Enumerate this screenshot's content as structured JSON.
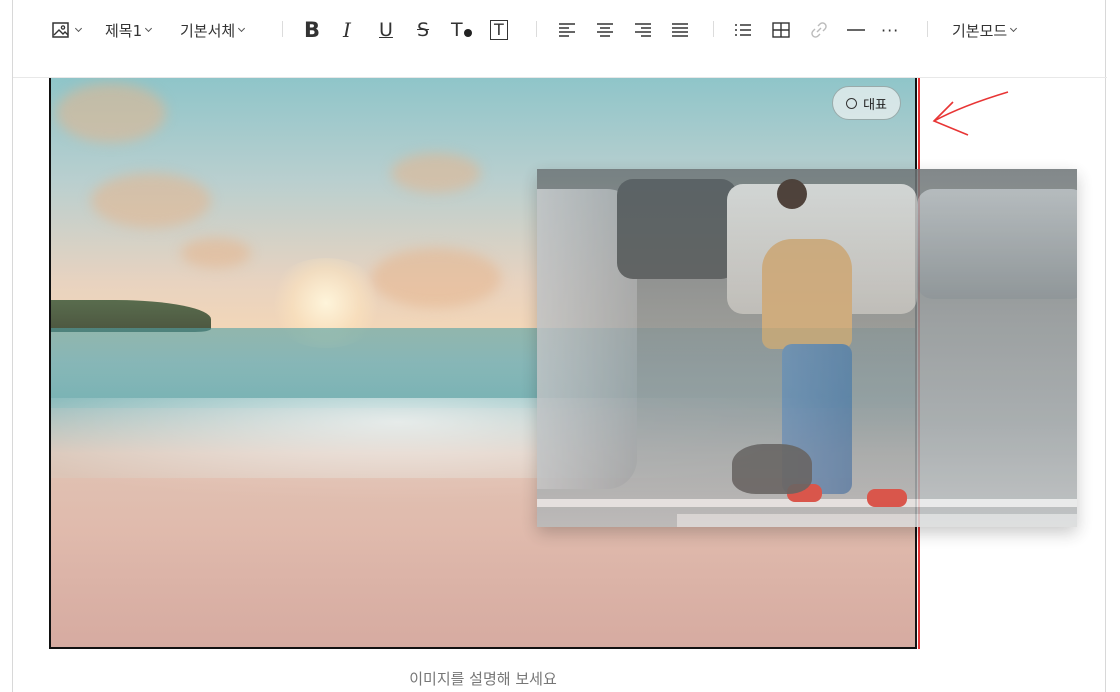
{
  "toolbar": {
    "heading_label": "제목1",
    "font_label": "기본서체",
    "bold_label": "B",
    "italic_label": "I",
    "underline_label": "U",
    "strike_label": "S",
    "text_color_label": "T",
    "text_bg_label": "T",
    "more_label": "···",
    "mode_label": "기본모드"
  },
  "image": {
    "representative_label": "대표",
    "caption_placeholder": "이미지를 설명해 보세요"
  },
  "colors": {
    "drop_indicator": "#e83535",
    "annotation_arrow": "#e83535"
  }
}
